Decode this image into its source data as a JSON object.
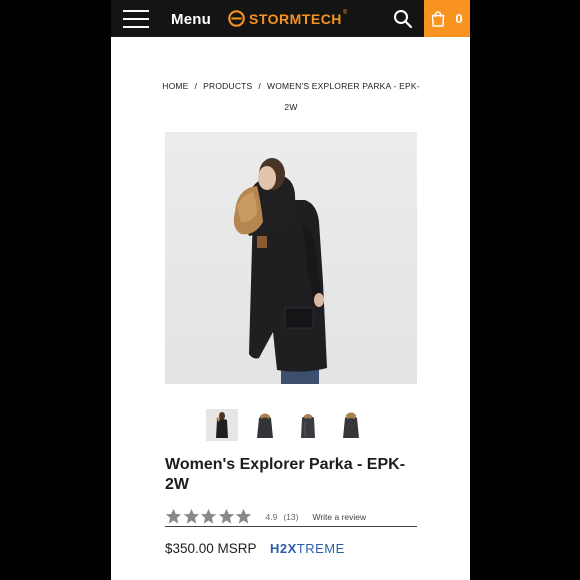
{
  "header": {
    "menu_label": "Menu",
    "brand_name": "STORMTECH",
    "brand_reg": "®",
    "cart_count": "0",
    "accent_color": "#f7931e"
  },
  "breadcrumb": {
    "home": "HOME",
    "sep1": "/",
    "products": "PRODUCTS",
    "sep2": "/",
    "current": "WOMEN'S EXPLORER PARKA - EPK-2W"
  },
  "gallery": {
    "main_image": "woman-in-black-parka-with-fur-hood",
    "thumbnails": [
      "model-front",
      "parka-front",
      "parka-side",
      "parka-back"
    ]
  },
  "product": {
    "title": "Women's Explorer Parka - EPK-2W",
    "rating_value": "4.9",
    "rating_count": "(13)",
    "stars": 5,
    "write_review": "Write a review",
    "price": "$350.00 MSRP",
    "tech_logo_bold": "H2X",
    "tech_logo_light": "TREME"
  }
}
